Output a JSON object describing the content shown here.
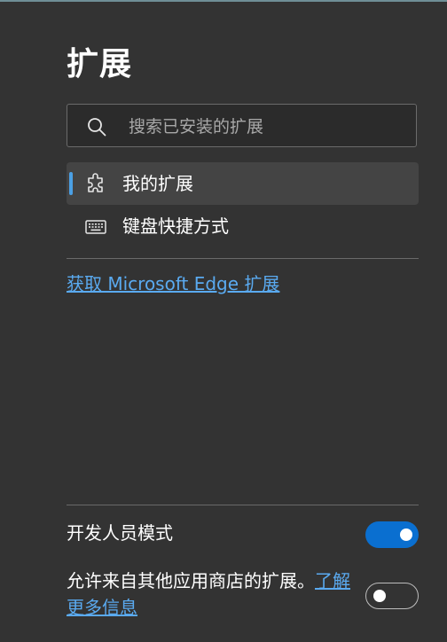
{
  "page": {
    "title": "扩展"
  },
  "search": {
    "placeholder": "搜索已安装的扩展",
    "value": ""
  },
  "nav": {
    "items": [
      {
        "label": "我的扩展",
        "icon": "puzzle-icon",
        "active": true
      },
      {
        "label": "键盘快捷方式",
        "icon": "keyboard-icon",
        "active": false
      }
    ]
  },
  "store": {
    "link_label": "获取 Microsoft Edge 扩展"
  },
  "developer_mode": {
    "label": "开发人员模式",
    "enabled": true
  },
  "other_stores": {
    "text": "允许来自其他应用商店的扩展。",
    "link_label": "了解更多信息",
    "enabled": false
  },
  "colors": {
    "background": "#333333",
    "accent": "#0a6fd0",
    "link": "#5aaaf0",
    "active_indicator": "#4ba0e5"
  }
}
